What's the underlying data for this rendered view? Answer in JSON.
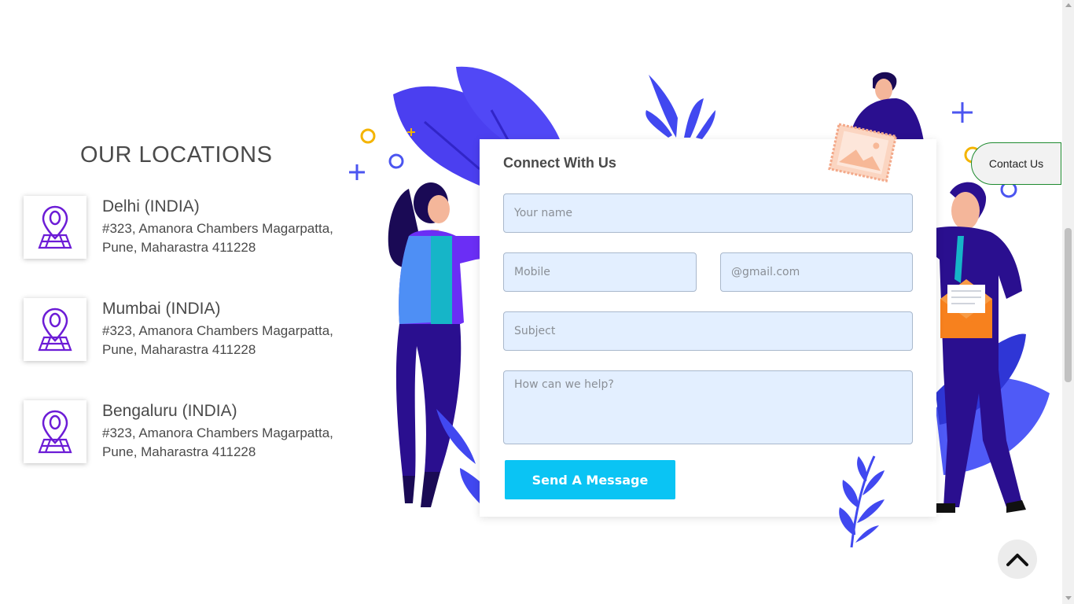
{
  "locations": {
    "heading": "OUR LOCATIONS",
    "items": [
      {
        "city": "Delhi (INDIA)",
        "address": "#323, Amanora Chambers Magarpatta, Pune, Maharastra 411228"
      },
      {
        "city": "Mumbai (INDIA)",
        "address": "#323, Amanora Chambers Magarpatta, Pune, Maharastra 411228"
      },
      {
        "city": "Bengaluru (INDIA)",
        "address": "#323, Amanora Chambers Magarpatta, Pune, Maharastra 411228"
      }
    ],
    "icon": "location-pin-map-icon"
  },
  "form": {
    "title": "Connect With Us",
    "name_placeholder": "Your name",
    "mobile_placeholder": "Mobile",
    "email_placeholder": "@gmail.com",
    "subject_placeholder": "Subject",
    "message_placeholder": "How can we help?",
    "submit_label": "Send A Message"
  },
  "contact_tab": {
    "label": "Contact Us"
  },
  "scroll_top": {
    "icon": "chevron-up-icon"
  },
  "colors": {
    "accent_purple": "#6c1cd6",
    "button_cyan": "#0ac4f4",
    "field_bg": "#e3efff",
    "illustration_blue": "#3f45f2",
    "illustration_indigo": "#2a0f8f"
  }
}
